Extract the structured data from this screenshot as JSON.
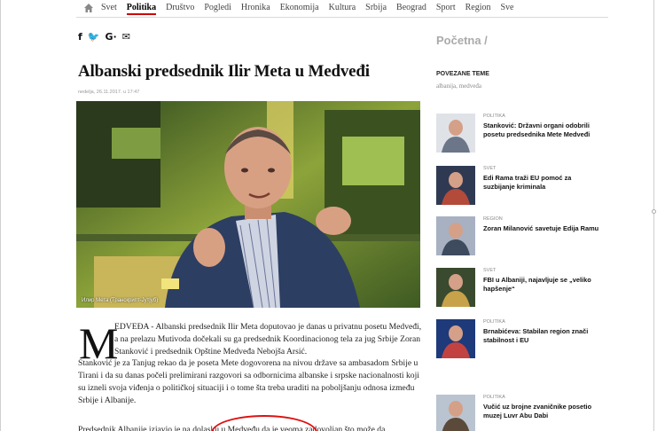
{
  "nav": {
    "items": [
      "Svet",
      "Politika",
      "Društvo",
      "Pogledi",
      "Hronika",
      "Ekonomija",
      "Kultura",
      "Srbija",
      "Beograd",
      "Sport",
      "Region",
      "Sve"
    ],
    "active": "Politika"
  },
  "social": [
    "f",
    "🐦",
    "G·",
    "✉"
  ],
  "article": {
    "title": "Albanski predsednik Ilir Meta u Medveđi",
    "date": "nedelja, 26.11.2017. u 17:47",
    "photo_caption": "Илир Мета (Транскрипт-Јутјуб)",
    "dropcap": "M",
    "lead": "EDVEĐA - Albanski predsednik Ilir Meta doputovao je danas u privatnu posetu Medveđi, a na prelazu Mutivoda dočekali su ga predsednik Koordinacionog tela za jug Srbije Zoran Stanković i predsednik Opštine Medveđa Nebojša Arsić.",
    "paragraph1": "Stanković je za Tanjug rekao da je poseta Mete dogovorena na nivou države sa ambasadom Srbije u Tirani i da su danas počeli prelimirani razgovori sa odbornicima albanske i srpske nacionalnosti koji su izneli svoja viđenja o političkoj situaciji i o tome šta treba uraditi na poboljšanju odnosa između Srbije i Albanije.",
    "paragraph2": "Predsednik Albanije izjavio je na dolasku u Medveđu da je veoma zadovoljan što može da"
  },
  "sidebar": {
    "header": "Početna  /",
    "related_title": "POVEZANE TEME",
    "related_tags": "albanija, medveđa",
    "items": [
      {
        "category": "POLITIKA",
        "headline": "Stanković: Državni organi odobrili posetu predsednika Mete Medveđi"
      },
      {
        "category": "SVET",
        "headline": "Edi Rama traži EU pomoć za suzbijanje kriminala"
      },
      {
        "category": "REGION",
        "headline": "Zoran Milanović savetuje Edija Ramu"
      },
      {
        "category": "SVET",
        "headline": "FBI u Albaniji, najavljuje se „veliko hapšenje“"
      },
      {
        "category": "POLITIKA",
        "headline": "Brnabićeva: Stabilan region znači stabilnost i EU"
      },
      {
        "category": "POLITIKA",
        "headline": "Vučić uz brojne zvaničnike posetio muzej Luvr Abu Dabi"
      }
    ]
  },
  "colors": {
    "accent": "#cc0000",
    "nav_text": "#444444",
    "muted": "#999999"
  }
}
